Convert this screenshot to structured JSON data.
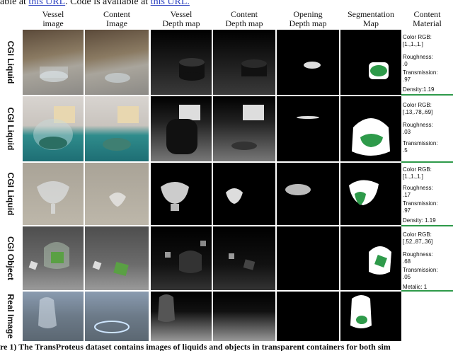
{
  "header_line": {
    "prefix": "able at ",
    "link1": "this URL",
    "middle": ". Code is available at ",
    "link2": "this URL."
  },
  "columns": [
    {
      "l1": "Vessel",
      "l2": "image"
    },
    {
      "l1": "Content",
      "l2": "Image"
    },
    {
      "l1": "Vessel",
      "l2": "Depth map"
    },
    {
      "l1": "Content",
      "l2": "Depth map"
    },
    {
      "l1": "Opening",
      "l2": "Depth map"
    },
    {
      "l1": "Segmentation",
      "l2": "Map"
    },
    {
      "l1": "Content",
      "l2": "Material"
    }
  ],
  "rows": [
    {
      "label": "CGI Liquid",
      "material": [
        "Color RGB:",
        "[1.,1.,1.]",
        "Roughness:",
        ".0",
        "Transmission:",
        ".97",
        "Density:1.19"
      ]
    },
    {
      "label": "CGI Liquid",
      "material": [
        "Color RGB:",
        "[.13,.78,.69]",
        "Roughness:",
        ".03",
        "Transmission:",
        ".5"
      ]
    },
    {
      "label": "CGI Liquid",
      "material": [
        "Color RGB:",
        "[1.,1.,1.]",
        "Roughness:",
        ".17",
        "Transmission:",
        ".97",
        "Density: 1.19"
      ]
    },
    {
      "label": "CGI Object",
      "material": [
        "Color RGB:",
        "[.52,.87,.36]",
        "Roughness:",
        ".68",
        "Transmission:",
        ".05",
        "Metalic: 1"
      ]
    },
    {
      "label": "Real Image",
      "material": []
    }
  ],
  "caption": "re 1) The TransProteus dataset contains images of liquids and objects in transparent containers for both sim",
  "colors": {
    "green": "#2e9a4a",
    "link": "#2a3fbf"
  }
}
